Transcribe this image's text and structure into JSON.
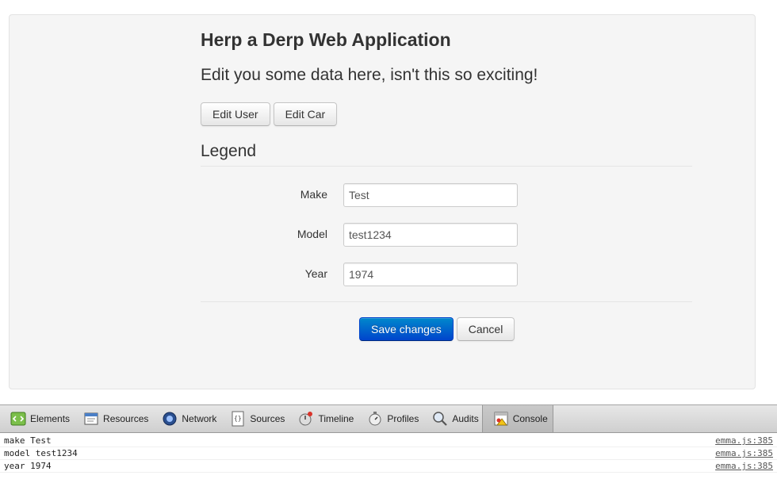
{
  "app": {
    "title": "Herp a Derp Web Application",
    "lead": "Edit you some data here, isn't this so exciting!",
    "buttons": [
      {
        "label": "Edit User"
      },
      {
        "label": "Edit Car"
      }
    ]
  },
  "form": {
    "legend": "Legend",
    "fields": [
      {
        "label": "Make",
        "value": "Test"
      },
      {
        "label": "Model",
        "value": "test1234"
      },
      {
        "label": "Year",
        "value": "1974"
      }
    ],
    "save_label": "Save changes",
    "cancel_label": "Cancel"
  },
  "devtools": {
    "tabs": [
      {
        "label": "Elements",
        "icon": "elements-icon"
      },
      {
        "label": "Resources",
        "icon": "resources-icon"
      },
      {
        "label": "Network",
        "icon": "network-icon"
      },
      {
        "label": "Sources",
        "icon": "sources-icon"
      },
      {
        "label": "Timeline",
        "icon": "timeline-icon"
      },
      {
        "label": "Profiles",
        "icon": "profiles-icon"
      },
      {
        "label": "Audits",
        "icon": "audits-icon"
      },
      {
        "label": "Console",
        "icon": "console-icon",
        "active": true
      }
    ],
    "console_rows": [
      {
        "message": "make Test",
        "source": "emma.js:385"
      },
      {
        "message": "model test1234",
        "source": "emma.js:385"
      },
      {
        "message": "year 1974",
        "source": "emma.js:385"
      }
    ]
  },
  "colors": {
    "primary": "#0066cc",
    "well_bg": "#f5f5f5"
  }
}
